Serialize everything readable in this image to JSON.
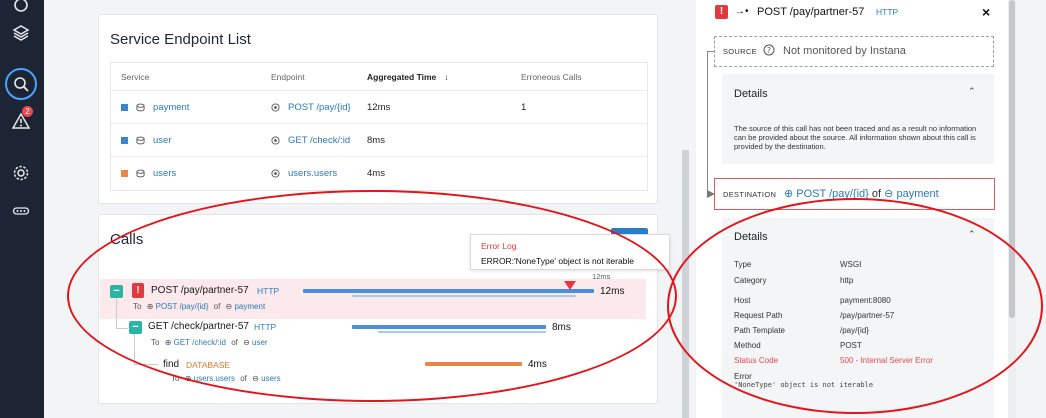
{
  "service_list": {
    "title": "Service Endpoint List",
    "columns": [
      "Service",
      "Endpoint",
      "Aggregated Time",
      "Erroneous Calls"
    ],
    "sort_arrow": "↓",
    "rows": [
      {
        "service": "payment",
        "endpoint": "POST /pay/{id}",
        "time": "12ms",
        "errors": "1",
        "color": "#3b86d4"
      },
      {
        "service": "user",
        "endpoint": "GET /check/:id",
        "time": "8ms",
        "errors": "",
        "color": "#3b86d4"
      },
      {
        "service": "users",
        "endpoint": "users.users",
        "time": "4ms",
        "errors": "",
        "color": "#e8864a"
      }
    ]
  },
  "calls": {
    "title": "Calls",
    "tooltip": {
      "title": "Error Log",
      "message": "ERROR:'NoneType' object is not iterable"
    },
    "tick_label": "12ms",
    "items": [
      {
        "name": "POST /pay/partner-57",
        "tag": "HTTP",
        "to_prefix": "To",
        "to_endpoint": "POST /pay/{id}",
        "of": "of",
        "to_service": "payment",
        "duration": "12ms"
      },
      {
        "name": "GET /check/partner-57",
        "tag": "HTTP",
        "to_prefix": "To",
        "to_endpoint": "GET /check/:id",
        "of": "of",
        "to_service": "user",
        "duration": "8ms"
      },
      {
        "name": "find",
        "tag": "DATABASE",
        "to_prefix": "To",
        "to_endpoint": "users.users",
        "of": "of",
        "to_service": "users",
        "duration": "4ms"
      }
    ]
  },
  "detail": {
    "header": {
      "badge": "!",
      "arrow": "→•",
      "title": "POST /pay/partner-57",
      "tag": "HTTP",
      "close": "×"
    },
    "source": {
      "label": "SOURCE",
      "text": "Not monitored by Instana"
    },
    "source_details": {
      "title": "Details",
      "text": "The source of this call has not been traced and as a result no information can be provided about the source. All information shown about this call is provided by the destination."
    },
    "destination": {
      "label": "DESTINATION",
      "endpoint": "POST /pay/{id}",
      "of": "of",
      "service": "payment"
    },
    "dest_details": {
      "title": "Details",
      "fields": [
        {
          "key": "Type",
          "value": "WSGI"
        },
        {
          "key": "Category",
          "value": "http"
        },
        {
          "key": "Host",
          "value": "payment:8080"
        },
        {
          "key": "Request Path",
          "value": "/pay/partner-57"
        },
        {
          "key": "Path Template",
          "value": "/pay/{id}"
        },
        {
          "key": "Method",
          "value": "POST"
        },
        {
          "key": "Status Code",
          "value": "500 - Internal Server Error",
          "error": true
        }
      ],
      "error_label": "Error",
      "error_text": "'NoneType' object is not iterable"
    }
  },
  "rail": {
    "badge_count": "2"
  },
  "colors": {
    "accent": "#2a7ec8",
    "error": "#e03a3e",
    "teal": "#2bb3a3",
    "annotation": "#e4141b"
  }
}
